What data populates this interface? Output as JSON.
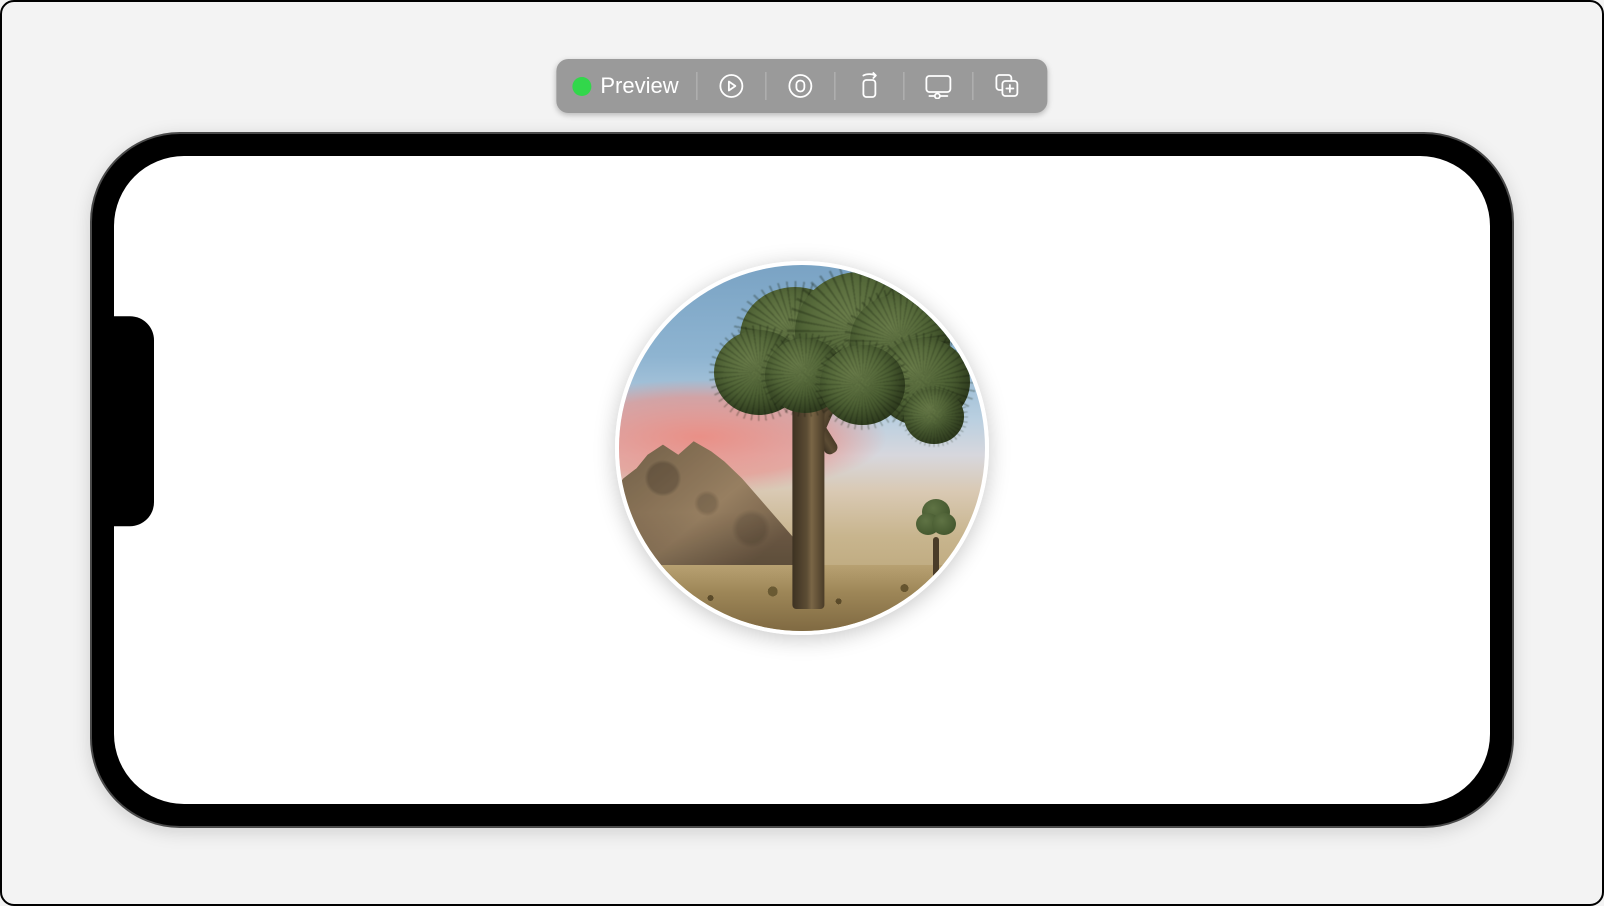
{
  "toolbar": {
    "status": "running",
    "status_color": "#32d74b",
    "preview_label": "Preview",
    "buttons": {
      "live": "live-preview-icon",
      "accessibility": "accessibility-inspector-icon",
      "orientation": "rotate-device-icon",
      "device": "device-settings-icon",
      "duplicate": "duplicate-preview-icon"
    }
  },
  "device": {
    "orientation": "landscape",
    "screen_background": "#ffffff"
  },
  "content": {
    "image_semantic": "joshua-tree-sunset-photo",
    "shape": "circle",
    "border_color": "#ffffff"
  }
}
